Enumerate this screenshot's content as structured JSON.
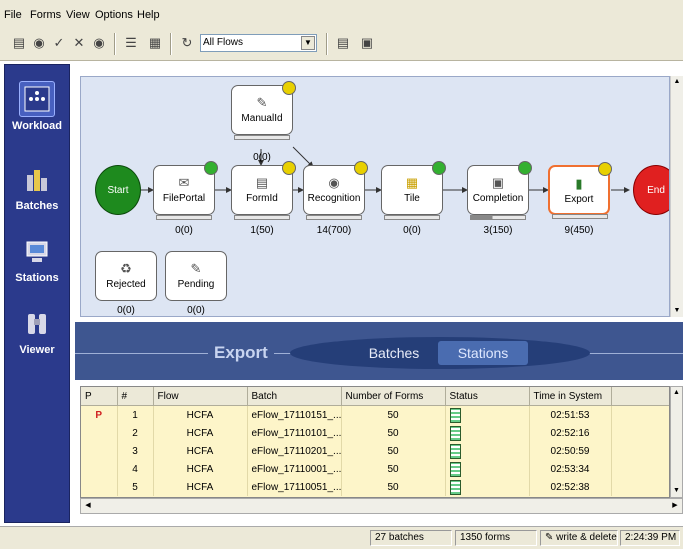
{
  "menu": {
    "items": [
      "File",
      "Forms",
      "View",
      "Options",
      "Help"
    ]
  },
  "toolbar": {
    "flow_filter": "All Flows"
  },
  "sidebar": {
    "items": [
      {
        "label": "Workload",
        "icon": "workload-icon"
      },
      {
        "label": "Batches",
        "icon": "batches-icon"
      },
      {
        "label": "Stations",
        "icon": "stations-icon"
      },
      {
        "label": "Viewer",
        "icon": "viewer-icon"
      }
    ]
  },
  "workflow": {
    "start_label": "Start",
    "end_label": "End",
    "nodes": [
      {
        "label": "ManualId",
        "count": "0(0)",
        "status": "yellow"
      },
      {
        "label": "FilePortal",
        "count": "0(0)",
        "status": "green"
      },
      {
        "label": "FormId",
        "count": "1(50)",
        "status": "yellow"
      },
      {
        "label": "Recognition",
        "count": "14(700)",
        "status": "yellow"
      },
      {
        "label": "Tile",
        "count": "0(0)",
        "status": "green"
      },
      {
        "label": "Completion",
        "count": "3(150)",
        "status": "green"
      },
      {
        "label": "Export",
        "count": "9(450)",
        "status": "yellow"
      },
      {
        "label": "Rejected",
        "count": "0(0)",
        "status": "none"
      },
      {
        "label": "Pending",
        "count": "0(0)",
        "status": "none"
      }
    ]
  },
  "band": {
    "title": "Export",
    "tabs": [
      "Batches",
      "Stations"
    ],
    "active_tab": "Stations"
  },
  "grid": {
    "columns": [
      "P",
      "#",
      "Flow",
      "Batch",
      "Number of Forms",
      "Status",
      "Time in System"
    ],
    "rows": [
      {
        "p": "P",
        "num": "1",
        "flow": "HCFA",
        "batch": "eFlow_17110151_...",
        "forms": "50",
        "time": "02:51:53"
      },
      {
        "p": "",
        "num": "2",
        "flow": "HCFA",
        "batch": "eFlow_17110101_...",
        "forms": "50",
        "time": "02:52:16"
      },
      {
        "p": "",
        "num": "3",
        "flow": "HCFA",
        "batch": "eFlow_17110201_...",
        "forms": "50",
        "time": "02:50:59"
      },
      {
        "p": "",
        "num": "4",
        "flow": "HCFA",
        "batch": "eFlow_17110001_...",
        "forms": "50",
        "time": "02:53:34"
      },
      {
        "p": "",
        "num": "5",
        "flow": "HCFA",
        "batch": "eFlow_17110051_...",
        "forms": "50",
        "time": "02:52:38"
      }
    ]
  },
  "status": {
    "batches": "27 batches",
    "forms": "1350 forms",
    "mode": "write & delete",
    "clock": "2:24:39 PM"
  },
  "colors": {
    "sidebar": "#2b3a8c",
    "band": "#3e5690",
    "start": "#1e8a1e",
    "end": "#e02020",
    "led_green": "#33b030",
    "led_yellow": "#e8d000",
    "selected_node": "#f07030"
  }
}
